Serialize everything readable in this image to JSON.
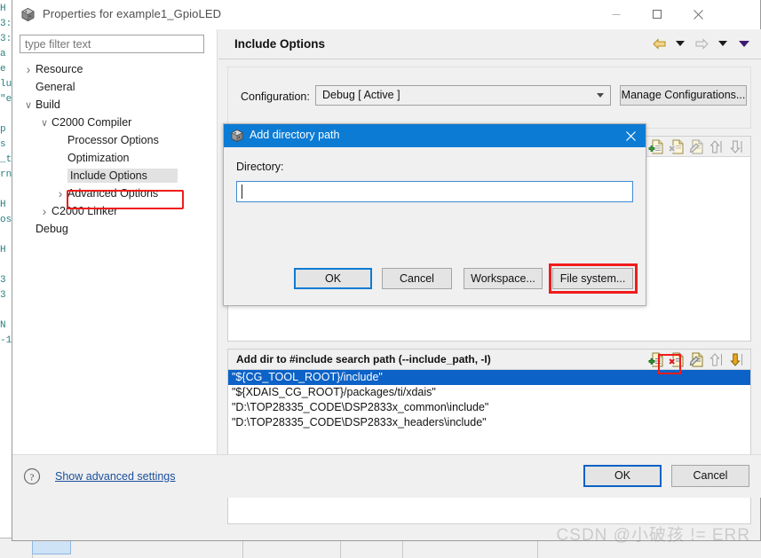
{
  "window": {
    "title": "Properties for example1_GpioLED",
    "app_icon": "cube-icon",
    "minimize_label": "Minimize",
    "maximize_label": "Maximize",
    "close_label": "Close"
  },
  "filter": {
    "placeholder": "type filter text",
    "value": ""
  },
  "tree": {
    "items": [
      {
        "label": "Resource",
        "twist": "collapsed",
        "indent": 0,
        "selected": false
      },
      {
        "label": "General",
        "twist": "none",
        "indent": 0,
        "selected": false
      },
      {
        "label": "Build",
        "twist": "expanded",
        "indent": 0,
        "selected": false
      },
      {
        "label": "C2000 Compiler",
        "twist": "expanded",
        "indent": 1,
        "selected": false
      },
      {
        "label": "Processor Options",
        "twist": "none",
        "indent": 2,
        "selected": false
      },
      {
        "label": "Optimization",
        "twist": "none",
        "indent": 2,
        "selected": false
      },
      {
        "label": "Include Options",
        "twist": "none",
        "indent": 2,
        "selected": true
      },
      {
        "label": "Advanced Options",
        "twist": "collapsed",
        "indent": 2,
        "selected": false
      },
      {
        "label": "C2000 Linker",
        "twist": "collapsed",
        "indent": 1,
        "selected": false
      },
      {
        "label": "Debug",
        "twist": "none",
        "indent": 0,
        "selected": false
      }
    ]
  },
  "page": {
    "title": "Include Options",
    "nav": {
      "back_icon": "back-arrow-icon",
      "back_menu_icon": "chevron-down-icon",
      "forward_icon": "forward-arrow-icon",
      "forward_menu_icon": "chevron-down-icon",
      "overflow_icon": "chevron-down-icon"
    }
  },
  "configuration": {
    "label": "Configuration:",
    "value": "Debug  [ Active ]",
    "dropdown_icon": "chevron-down-icon",
    "manage_button": "Manage Configurations..."
  },
  "group_hidden": {
    "toolbar": [
      {
        "name": "add-icon",
        "tip": "Add"
      },
      {
        "name": "delete-icon",
        "tip": "Delete"
      },
      {
        "name": "edit-icon",
        "tip": "Edit"
      },
      {
        "name": "move-up-icon",
        "tip": "Move Up"
      },
      {
        "name": "move-down-icon",
        "tip": "Move Down"
      }
    ],
    "rows": []
  },
  "include_group": {
    "header": "Add dir to #include search path (--include_path, -I)",
    "toolbar": [
      {
        "name": "add-icon",
        "tip": "Add"
      },
      {
        "name": "delete-icon",
        "tip": "Delete"
      },
      {
        "name": "edit-icon",
        "tip": "Edit"
      },
      {
        "name": "move-up-icon",
        "tip": "Move Up"
      },
      {
        "name": "move-down-icon",
        "tip": "Move Down"
      }
    ],
    "rows": [
      {
        "value": "\"${CG_TOOL_ROOT}/include\"",
        "selected": true
      },
      {
        "value": "\"${XDAIS_CG_ROOT}/packages/ti/xdais\"",
        "selected": false
      },
      {
        "value": "\"D:\\TOP28335_CODE\\DSP2833x_common\\include\"",
        "selected": false
      },
      {
        "value": "\"D:\\TOP28335_CODE\\DSP2833x_headers\\include\"",
        "selected": false
      }
    ]
  },
  "bottom": {
    "help_icon": "question-mark-icon",
    "advanced_link": "Show advanced settings",
    "ok": "OK",
    "cancel": "Cancel"
  },
  "dialog": {
    "icon": "cube-icon",
    "title": "Add directory path",
    "close_icon": "close-icon",
    "field_label": "Directory:",
    "field_value": "",
    "buttons": {
      "ok": "OK",
      "cancel": "Cancel",
      "workspace": "Workspace...",
      "file_system": "File system..."
    }
  },
  "watermark": "CSDN @小破孩 != ERR",
  "background_code": {
    "lines": [
      "H",
      "3:",
      "3:",
      "a",
      "e",
      "lu",
      "\"e",
      "",
      "p",
      "s",
      "_t",
      "rn",
      "",
      "H",
      "os",
      "",
      "H",
      "",
      "3",
      "3",
      "",
      "N",
      "-1"
    ]
  },
  "colors": {
    "dialog_title": "#0c7bd4",
    "highlight_red": "#f01c1c",
    "selection_blue": "#0c62c7",
    "link_blue": "#1a4f9c"
  }
}
